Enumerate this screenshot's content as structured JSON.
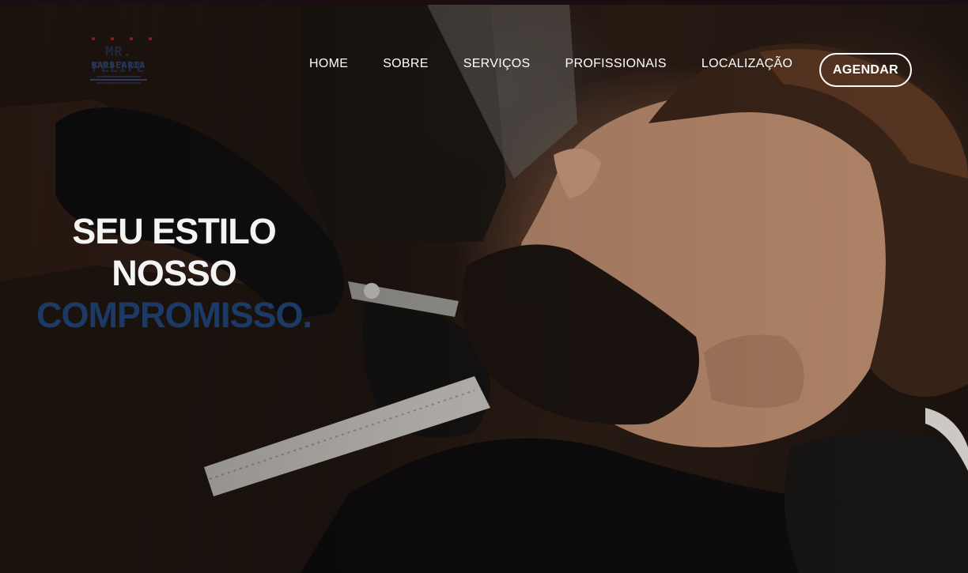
{
  "brand": {
    "logo_top": "MR. FELIPE",
    "logo_sub": "BARBEARIA"
  },
  "nav": {
    "items": [
      {
        "label": "HOME"
      },
      {
        "label": "SOBRE"
      },
      {
        "label": "SERVIÇOS"
      },
      {
        "label": "PROFISSIONAIS"
      },
      {
        "label": "LOCALIZAÇÃO"
      }
    ],
    "cta_label": "AGENDAR"
  },
  "hero": {
    "line1": "SEU ESTILO",
    "line2": "NOSSO",
    "line3": "COMPROMISSO."
  },
  "colors": {
    "accent_blue": "#1b3a66",
    "text_white": "#ffffff",
    "top_strip": "#1b0e12"
  }
}
